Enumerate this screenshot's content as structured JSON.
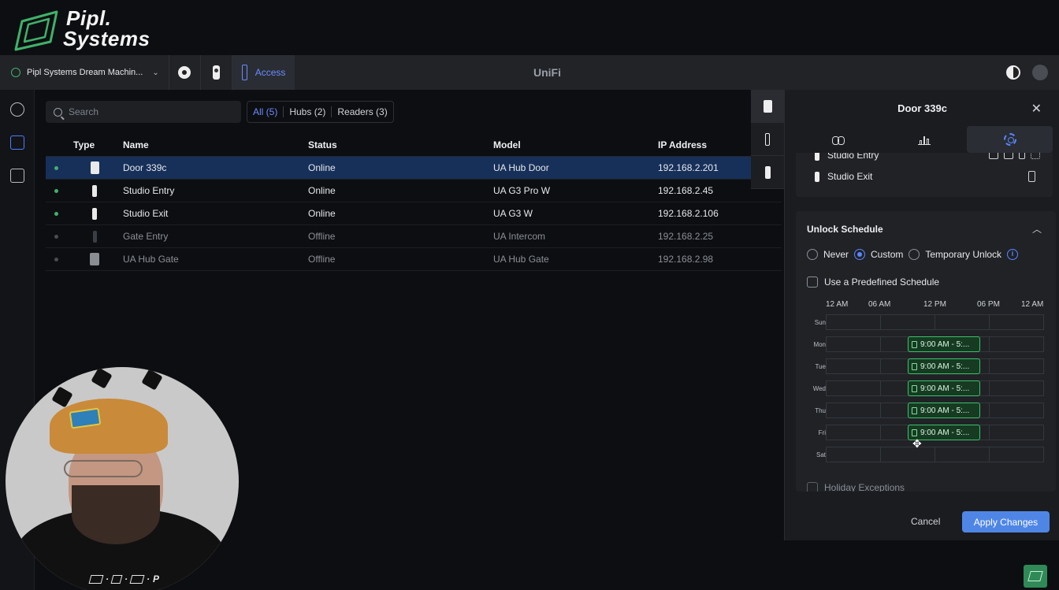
{
  "brand": {
    "line1": "Pipl.",
    "line2": "Systems",
    "logo_icon": "pipl-logo-icon"
  },
  "topbar": {
    "site_name": "Pipl Systems Dream Machin...",
    "active_app": "Access",
    "center_title": "UniFi"
  },
  "search": {
    "placeholder": "Search",
    "value": ""
  },
  "filters": [
    {
      "label": "All (5)",
      "active": true
    },
    {
      "label": "Hubs (2)",
      "active": false
    },
    {
      "label": "Readers (3)",
      "active": false
    }
  ],
  "table": {
    "headers": {
      "type": "Type",
      "name": "Name",
      "status": "Status",
      "model": "Model",
      "ip": "IP Address"
    },
    "rows": [
      {
        "name": "Door 339c",
        "status": "Online",
        "model": "UA Hub Door",
        "ip": "192.168.2.201",
        "device": "hub",
        "selected": true
      },
      {
        "name": "Studio Entry",
        "status": "Online",
        "model": "UA G3 Pro W",
        "ip": "192.168.2.45",
        "device": "reader"
      },
      {
        "name": "Studio Exit",
        "status": "Online",
        "model": "UA G3 W",
        "ip": "192.168.2.106",
        "device": "reader"
      },
      {
        "name": "Gate Entry",
        "status": "Offline",
        "model": "UA Intercom",
        "ip": "192.168.2.25",
        "device": "intercom"
      },
      {
        "name": "UA Hub Gate",
        "status": "Offline",
        "model": "UA Hub Gate",
        "ip": "192.168.2.98",
        "device": "gate"
      }
    ]
  },
  "panel": {
    "title": "Door 339c",
    "readers": [
      {
        "name": "Studio Entry"
      },
      {
        "name": "Studio Exit"
      }
    ],
    "schedule": {
      "title": "Unlock Schedule",
      "options": [
        "Never",
        "Custom",
        "Temporary Unlock"
      ],
      "selected": "Custom",
      "predefined_label": "Use a Predefined Schedule",
      "hours": [
        "12 AM",
        "06 AM",
        "12 PM",
        "06 PM",
        "12 AM"
      ],
      "days": [
        {
          "label": "Sun",
          "block": ""
        },
        {
          "label": "Mon",
          "block": "9:00 AM - 5:..."
        },
        {
          "label": "Tue",
          "block": "9:00 AM - 5:..."
        },
        {
          "label": "Wed",
          "block": "9:00 AM - 5:..."
        },
        {
          "label": "Thu",
          "block": "9:00 AM - 5:..."
        },
        {
          "label": "Fri",
          "block": "9:00 AM - 5:..."
        },
        {
          "label": "Sat",
          "block": ""
        }
      ],
      "holiday_label": "Holiday Exceptions"
    },
    "cancel_label": "Cancel",
    "apply_label": "Apply Changes"
  },
  "watermark": {
    "text": "P"
  },
  "colors": {
    "accent": "#5b86ff",
    "online": "#3fb26a",
    "selected_row": "#17305a",
    "schedule_block": "#3ec06a",
    "apply_button": "#4f86e6"
  }
}
